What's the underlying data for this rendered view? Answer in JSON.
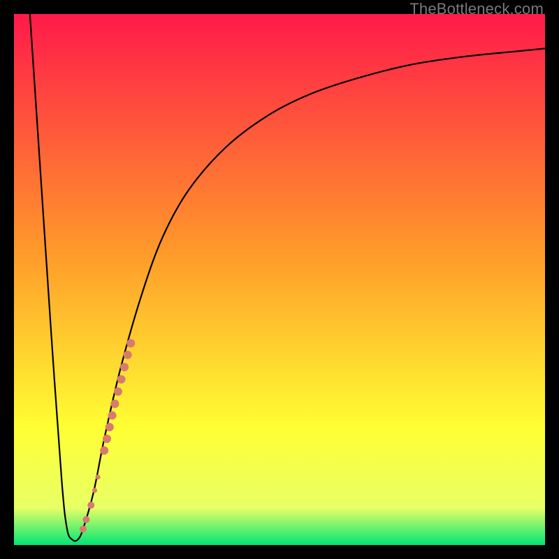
{
  "watermark": "TheBottleneck.com",
  "colors": {
    "frame": "#000000",
    "curve": "#000000",
    "marker": "#d87a6f",
    "gradient_top": "#ff1a4a",
    "gradient_mid1": "#ff9a2a",
    "gradient_mid2": "#ffff33",
    "gradient_mid3": "#e8ff66",
    "gradient_bottom": "#00e676"
  },
  "chart_data": {
    "type": "line",
    "title": "",
    "xlabel": "",
    "ylabel": "",
    "xlim": [
      0,
      100
    ],
    "ylim": [
      0,
      100
    ],
    "series": [
      {
        "name": "curve",
        "x": [
          3,
          5,
          7,
          9,
          10,
          11,
          12,
          13,
          15,
          17,
          20,
          24,
          28,
          33,
          40,
          48,
          56,
          65,
          75,
          85,
          95,
          100
        ],
        "y": [
          100,
          70,
          40,
          12,
          3,
          1,
          1,
          3,
          10,
          20,
          33,
          47,
          58,
          67,
          75,
          81,
          85,
          88,
          90.5,
          92,
          93,
          93.5
        ]
      }
    ],
    "markers": {
      "name": "segment-highlight",
      "type": "scatter",
      "color": "#d87a6f",
      "points": [
        {
          "x": 13.0,
          "y": 3.0,
          "r": 5
        },
        {
          "x": 13.6,
          "y": 4.8,
          "r": 5
        },
        {
          "x": 14.5,
          "y": 7.5,
          "r": 5
        },
        {
          "x": 15.2,
          "y": 10.3,
          "r": 3.5
        },
        {
          "x": 15.8,
          "y": 12.8,
          "r": 3.5
        },
        {
          "x": 17.0,
          "y": 17.8,
          "r": 6
        },
        {
          "x": 17.5,
          "y": 20.0,
          "r": 6
        },
        {
          "x": 18.0,
          "y": 22.2,
          "r": 6
        },
        {
          "x": 18.5,
          "y": 24.4,
          "r": 6
        },
        {
          "x": 19.0,
          "y": 26.6,
          "r": 6
        },
        {
          "x": 19.6,
          "y": 28.9,
          "r": 6
        },
        {
          "x": 20.2,
          "y": 31.2,
          "r": 6
        },
        {
          "x": 20.8,
          "y": 33.5,
          "r": 6
        },
        {
          "x": 21.4,
          "y": 35.8,
          "r": 6
        },
        {
          "x": 22.0,
          "y": 38.0,
          "r": 6
        }
      ]
    }
  }
}
